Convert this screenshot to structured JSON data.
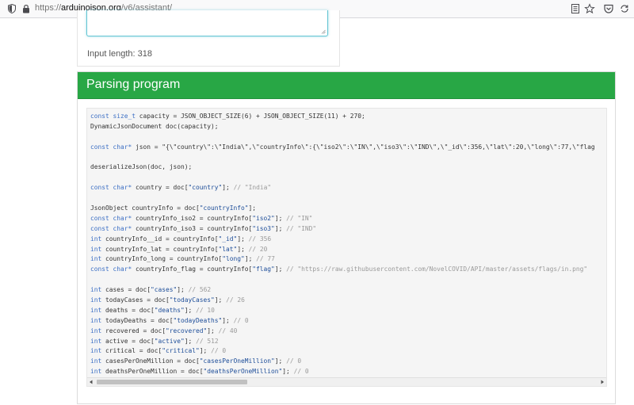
{
  "browser": {
    "url_prefix": "https://",
    "url_host": "arduinojson.org",
    "url_path": "/v6/assistant/"
  },
  "input_section": {
    "input_length": "Input length: 318"
  },
  "panel": {
    "title": "Parsing program"
  },
  "code_lines": [
    [
      {
        "t": "kw",
        "v": "const size_t"
      },
      {
        "t": "p",
        "v": " capacity = JSON_OBJECT_SIZE(6) + JSON_OBJECT_SIZE(11) + 270;"
      }
    ],
    [
      {
        "t": "p",
        "v": "DynamicJsonDocument doc(capacity);"
      }
    ],
    [],
    [
      {
        "t": "kw",
        "v": "const char*"
      },
      {
        "t": "p",
        "v": " json = \"{\\\"country\\\":\\\"India\\\",\\\"countryInfo\\\":{\\\"iso2\\\":\\\"IN\\\",\\\"iso3\\\":\\\"IND\\\",\\\"_id\\\":356,\\\"lat\\\":20,\\\"long\\\":77,\\\"flag"
      }
    ],
    [],
    [
      {
        "t": "p",
        "v": "deserializeJson(doc, json);"
      }
    ],
    [],
    [
      {
        "t": "kw",
        "v": "const char*"
      },
      {
        "t": "p",
        "v": " country = doc["
      },
      {
        "t": "str",
        "v": "\"country\""
      },
      {
        "t": "p",
        "v": "]; "
      },
      {
        "t": "cm",
        "v": "// \"India\""
      }
    ],
    [],
    [
      {
        "t": "p",
        "v": "JsonObject countryInfo = doc["
      },
      {
        "t": "str",
        "v": "\"countryInfo\""
      },
      {
        "t": "p",
        "v": "];"
      }
    ],
    [
      {
        "t": "kw",
        "v": "const char*"
      },
      {
        "t": "p",
        "v": " countryInfo_iso2 = countryInfo["
      },
      {
        "t": "str",
        "v": "\"iso2\""
      },
      {
        "t": "p",
        "v": "]; "
      },
      {
        "t": "cm",
        "v": "// \"IN\""
      }
    ],
    [
      {
        "t": "kw",
        "v": "const char*"
      },
      {
        "t": "p",
        "v": " countryInfo_iso3 = countryInfo["
      },
      {
        "t": "str",
        "v": "\"iso3\""
      },
      {
        "t": "p",
        "v": "]; "
      },
      {
        "t": "cm",
        "v": "// \"IND\""
      }
    ],
    [
      {
        "t": "kw",
        "v": "int"
      },
      {
        "t": "p",
        "v": " countryInfo__id = countryInfo["
      },
      {
        "t": "str",
        "v": "\"_id\""
      },
      {
        "t": "p",
        "v": "]; "
      },
      {
        "t": "cm",
        "v": "// 356"
      }
    ],
    [
      {
        "t": "kw",
        "v": "int"
      },
      {
        "t": "p",
        "v": " countryInfo_lat = countryInfo["
      },
      {
        "t": "str",
        "v": "\"lat\""
      },
      {
        "t": "p",
        "v": "]; "
      },
      {
        "t": "cm",
        "v": "// 20"
      }
    ],
    [
      {
        "t": "kw",
        "v": "int"
      },
      {
        "t": "p",
        "v": " countryInfo_long = countryInfo["
      },
      {
        "t": "str",
        "v": "\"long\""
      },
      {
        "t": "p",
        "v": "]; "
      },
      {
        "t": "cm",
        "v": "// 77"
      }
    ],
    [
      {
        "t": "kw",
        "v": "const char*"
      },
      {
        "t": "p",
        "v": " countryInfo_flag = countryInfo["
      },
      {
        "t": "str",
        "v": "\"flag\""
      },
      {
        "t": "p",
        "v": "]; "
      },
      {
        "t": "cm",
        "v": "// \"https://raw.githubusercontent.com/NovelCOVID/API/master/assets/flags/in.png\""
      }
    ],
    [],
    [
      {
        "t": "kw",
        "v": "int"
      },
      {
        "t": "p",
        "v": " cases = doc["
      },
      {
        "t": "str",
        "v": "\"cases\""
      },
      {
        "t": "p",
        "v": "]; "
      },
      {
        "t": "cm",
        "v": "// 562"
      }
    ],
    [
      {
        "t": "kw",
        "v": "int"
      },
      {
        "t": "p",
        "v": " todayCases = doc["
      },
      {
        "t": "str",
        "v": "\"todayCases\""
      },
      {
        "t": "p",
        "v": "]; "
      },
      {
        "t": "cm",
        "v": "// 26"
      }
    ],
    [
      {
        "t": "kw",
        "v": "int"
      },
      {
        "t": "p",
        "v": " deaths = doc["
      },
      {
        "t": "str",
        "v": "\"deaths\""
      },
      {
        "t": "p",
        "v": "]; "
      },
      {
        "t": "cm",
        "v": "// 10"
      }
    ],
    [
      {
        "t": "kw",
        "v": "int"
      },
      {
        "t": "p",
        "v": " todayDeaths = doc["
      },
      {
        "t": "str",
        "v": "\"todayDeaths\""
      },
      {
        "t": "p",
        "v": "]; "
      },
      {
        "t": "cm",
        "v": "// 0"
      }
    ],
    [
      {
        "t": "kw",
        "v": "int"
      },
      {
        "t": "p",
        "v": " recovered = doc["
      },
      {
        "t": "str",
        "v": "\"recovered\""
      },
      {
        "t": "p",
        "v": "]; "
      },
      {
        "t": "cm",
        "v": "// 40"
      }
    ],
    [
      {
        "t": "kw",
        "v": "int"
      },
      {
        "t": "p",
        "v": " active = doc["
      },
      {
        "t": "str",
        "v": "\"active\""
      },
      {
        "t": "p",
        "v": "]; "
      },
      {
        "t": "cm",
        "v": "// 512"
      }
    ],
    [
      {
        "t": "kw",
        "v": "int"
      },
      {
        "t": "p",
        "v": " critical = doc["
      },
      {
        "t": "str",
        "v": "\"critical\""
      },
      {
        "t": "p",
        "v": "]; "
      },
      {
        "t": "cm",
        "v": "// 0"
      }
    ],
    [
      {
        "t": "kw",
        "v": "int"
      },
      {
        "t": "p",
        "v": " casesPerOneMillion = doc["
      },
      {
        "t": "str",
        "v": "\"casesPerOneMillion\""
      },
      {
        "t": "p",
        "v": "]; "
      },
      {
        "t": "cm",
        "v": "// 0"
      }
    ],
    [
      {
        "t": "kw",
        "v": "int"
      },
      {
        "t": "p",
        "v": " deathsPerOneMillion = doc["
      },
      {
        "t": "str",
        "v": "\"deathsPerOneMillion\""
      },
      {
        "t": "p",
        "v": "]; "
      },
      {
        "t": "cm",
        "v": "// 0"
      }
    ]
  ],
  "icons": {
    "shield": "shield-icon",
    "lock": "lock-icon",
    "reader": "reader-view-icon",
    "star": "bookmark-star-icon",
    "pocket": "pocket-icon",
    "sync": "sync-icon"
  },
  "colors": {
    "header_green": "#28a745",
    "keyword": "#3c6fc4",
    "string": "#1d4d99",
    "comment": "#9a9a9a",
    "textarea_focus": "#62c4d3"
  }
}
